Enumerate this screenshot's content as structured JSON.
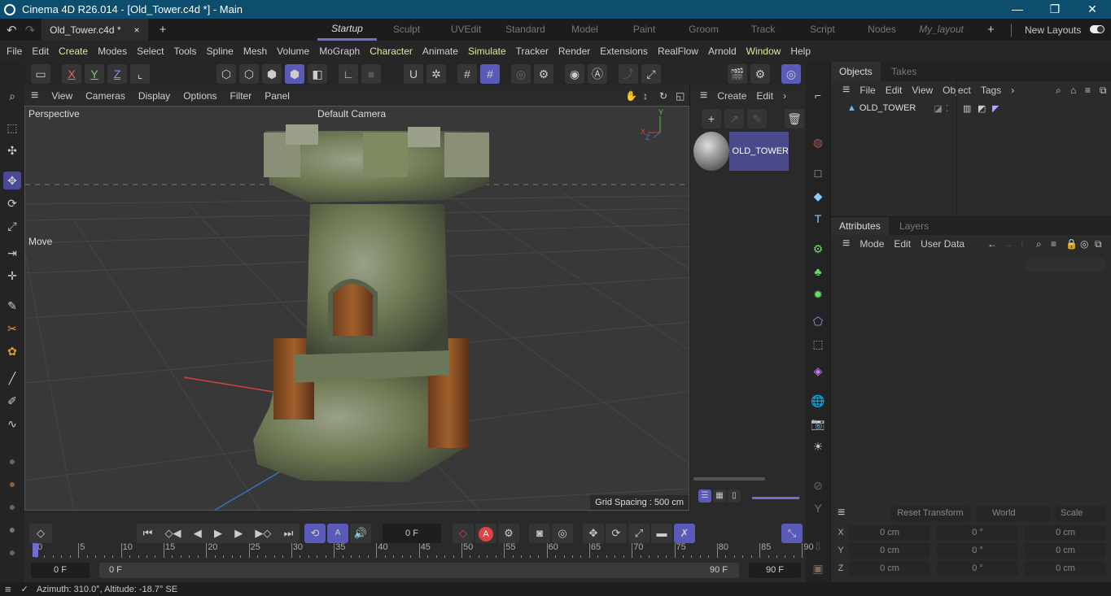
{
  "window": {
    "title": "Cinema 4D R26.014 - [Old_Tower.c4d *] - Main",
    "minimize": "—",
    "maximize": "❐",
    "close": "✕"
  },
  "tabs": {
    "document": "Old_Tower.c4d *",
    "close": "×",
    "add": "+",
    "layouts": [
      "Startup",
      "Sculpt",
      "UVEdit",
      "Standard",
      "Model",
      "Paint",
      "Groom",
      "Track",
      "Script",
      "Nodes",
      "My_layout"
    ],
    "active_layout": "Startup",
    "add_layout": "+",
    "new_layouts_label": "New Layouts",
    "new_layouts_on": true
  },
  "menu": [
    "File",
    "Edit",
    "Create",
    "Modes",
    "Select",
    "Tools",
    "Spline",
    "Mesh",
    "Volume",
    "MoGraph",
    "Character",
    "Animate",
    "Simulate",
    "Tracker",
    "Render",
    "Extensions",
    "RealFlow",
    "Arnold",
    "Window",
    "Help"
  ],
  "toolbar": {
    "axis_x": "X",
    "axis_y": "Y",
    "axis_z": "Z"
  },
  "viewport": {
    "menu": [
      "View",
      "Cameras",
      "Display",
      "Options",
      "Filter",
      "Panel"
    ],
    "name": "Perspective",
    "camera": "Default Camera",
    "tool": "Move",
    "grid_spacing": "Grid Spacing : 500 cm",
    "axis_y": "Y",
    "axis_x": "X",
    "axis_z": "Z"
  },
  "materials": {
    "menu": [
      "Create",
      "Edit"
    ],
    "items": [
      {
        "name": "OLD_TOWER"
      }
    ]
  },
  "objects": {
    "tabs": [
      "Objects",
      "Takes"
    ],
    "menu": [
      "File",
      "Edit",
      "View",
      "Object",
      "Tags"
    ],
    "items": [
      {
        "name": "OLD_TOWER"
      }
    ]
  },
  "attributes": {
    "tabs": [
      "Attributes",
      "Layers"
    ],
    "menu": [
      "Mode",
      "Edit",
      "User Data"
    ]
  },
  "coordinates": {
    "reset": "Reset Transform",
    "space": "World",
    "mode": "Scale",
    "rows": [
      {
        "axis": "X",
        "pos": "0 cm",
        "rot": "0 °",
        "scale": "0 cm"
      },
      {
        "axis": "Y",
        "pos": "0 cm",
        "rot": "0 °",
        "scale": "0 cm"
      },
      {
        "axis": "Z",
        "pos": "0 cm",
        "rot": "0 °",
        "scale": "0 cm"
      }
    ]
  },
  "timeline": {
    "current_frame": "0 F",
    "start": "0 F",
    "range_start": "0 F",
    "range_end": "90 F",
    "end": "90 F",
    "ticks": [
      "0",
      "5",
      "10",
      "15",
      "20",
      "25",
      "30",
      "35",
      "40",
      "45",
      "50",
      "55",
      "60",
      "65",
      "70",
      "75",
      "80",
      "85",
      "90"
    ]
  },
  "status": {
    "text": "Azimuth: 310.0°, Altitude: -18.7°  SE"
  }
}
